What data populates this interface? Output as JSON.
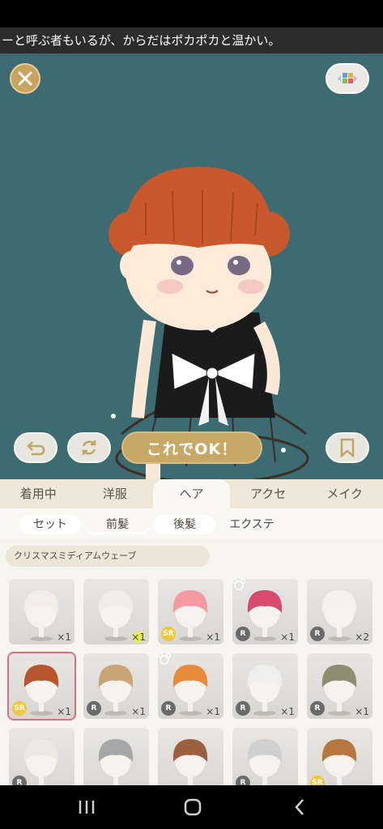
{
  "ticker": {
    "text": "ーと呼ぶ者もいるが、からだはポカポカと温かい。"
  },
  "buttons": {
    "ok_label": "これでOK！"
  },
  "tabs": [
    {
      "label": "着用中"
    },
    {
      "label": "洋服"
    },
    {
      "label": "ヘア"
    },
    {
      "label": "アクセ"
    },
    {
      "label": "メイク"
    }
  ],
  "active_tab": "ヘア",
  "subtabs": [
    {
      "label": "セット"
    },
    {
      "label": "前髪"
    },
    {
      "label": "後髪"
    },
    {
      "label": "エクステ"
    }
  ],
  "active_subtab": "前髪",
  "selected_item_name": "クリスマスミディアムウェーブ",
  "items": [
    {
      "hair": "#f2ede6",
      "rarity": "",
      "count": "×1"
    },
    {
      "hair": "#f0ede8",
      "rarity": "",
      "count": "×1"
    },
    {
      "hair": "#f39aa3",
      "rarity": "SR",
      "count": "×1"
    },
    {
      "hair": "#d84a6e",
      "rarity": "R",
      "count": "×1"
    },
    {
      "hair": "#f4f2ee",
      "rarity": "R",
      "count": "×2"
    },
    {
      "hair": "#b8552e",
      "rarity": "SR",
      "count": "×1"
    },
    {
      "hair": "#c9a474",
      "rarity": "R",
      "count": "×1"
    },
    {
      "hair": "#e88a3a",
      "rarity": "R",
      "count": "×1"
    },
    {
      "hair": "#eeeeee",
      "rarity": "R",
      "count": "×1"
    },
    {
      "hair": "#8b8f70",
      "rarity": "R",
      "count": "×1"
    },
    {
      "hair": "#ece8e2",
      "rarity": "R",
      "count": ""
    },
    {
      "hair": "#a7a7a7",
      "rarity": "",
      "count": ""
    },
    {
      "hair": "#9a6040",
      "rarity": "",
      "count": ""
    },
    {
      "hair": "#cfcfcf",
      "rarity": "R",
      "count": ""
    },
    {
      "hair": "#b5773e",
      "rarity": "SR",
      "count": ""
    }
  ],
  "colors": {
    "stage_bg": "#3c6c72",
    "accent_gold": "#c7a865",
    "selection": "#e06c80"
  }
}
